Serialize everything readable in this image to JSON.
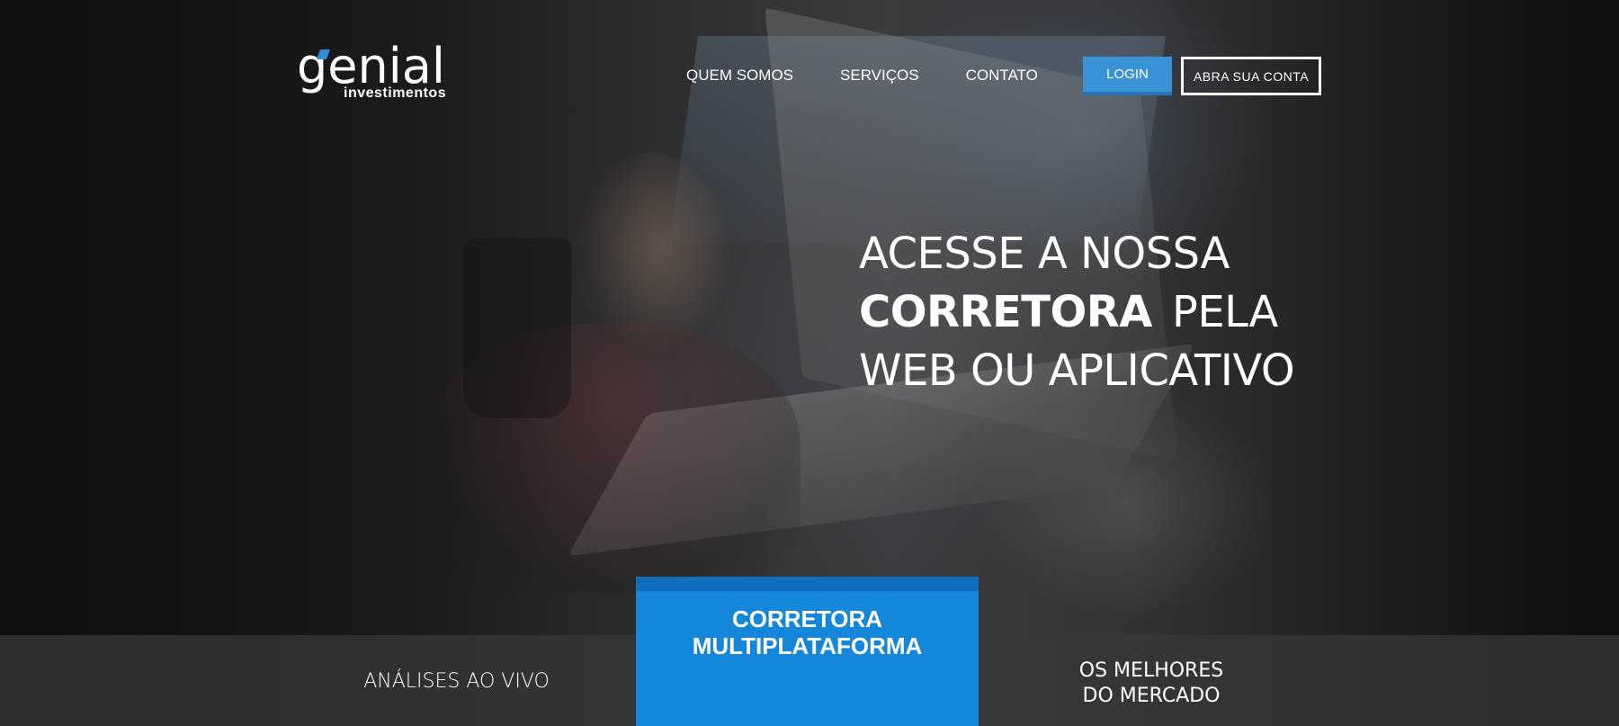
{
  "brand": {
    "name": "genial",
    "subtitle": "investimentos",
    "accent_color": "#2d8fd8"
  },
  "nav": {
    "items": [
      {
        "label": "QUEM SOMOS"
      },
      {
        "label": "SERVIÇOS"
      },
      {
        "label": "CONTATO"
      }
    ]
  },
  "header": {
    "login_label": "LOGIN",
    "open_account_label": "ABRA SUA CONTA",
    "login_color": "#3a93d6"
  },
  "hero": {
    "line1": "ACESSE A NOSSA",
    "line2_strong": "CORRETORA",
    "line2_rest": "PELA",
    "line3": "WEB OU APLICATIVO"
  },
  "features": {
    "left": "ANÁLISES AO VIVO",
    "center_line1": "CORRETORA",
    "center_line2": "MULTIPLATAFORMA",
    "center_color": "#1487db",
    "right_line1": "OS MELHORES",
    "right_line2": "DO MERCADO"
  }
}
